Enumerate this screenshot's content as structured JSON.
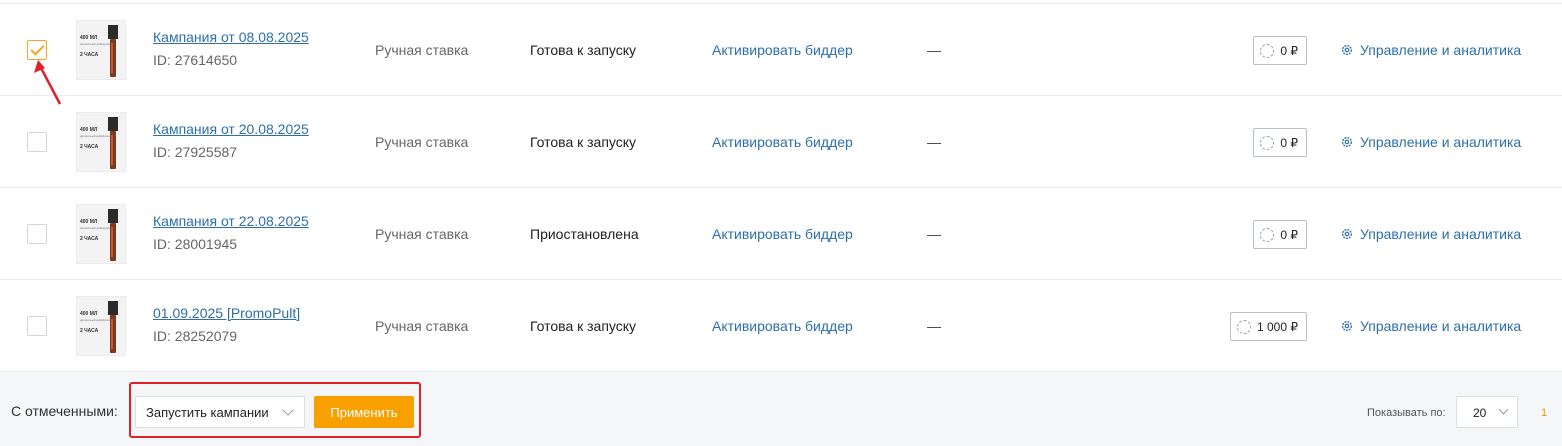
{
  "campaigns": [
    {
      "checked": true,
      "thumb": {
        "volume": "400 МЛ",
        "small": "ароматный диффузор",
        "duration": "2 ЧАСА"
      },
      "name": "Кампания от 08.08.2025",
      "id": "ID: 27614650",
      "bid_type": "Ручная ставка",
      "status": "Готова к запуску",
      "activate": "Активировать биддер",
      "dash": "—",
      "budget": "0 ₽",
      "manage": "Управление и аналитика"
    },
    {
      "checked": false,
      "thumb": {
        "volume": "400 МЛ",
        "small": "ароматный диффузор",
        "duration": "2 ЧАСА"
      },
      "name": "Кампания от 20.08.2025",
      "id": "ID: 27925587",
      "bid_type": "Ручная ставка",
      "status": "Готова к запуску",
      "activate": "Активировать биддер",
      "dash": "—",
      "budget": "0 ₽",
      "manage": "Управление и аналитика"
    },
    {
      "checked": false,
      "thumb": {
        "volume": "400 МЛ",
        "small": "ароматный диффузор",
        "duration": "2 ЧАСА"
      },
      "name": "Кампания от 22.08.2025",
      "id": "ID: 28001945",
      "bid_type": "Ручная ставка",
      "status": "Приостановлена",
      "activate": "Активировать биддер",
      "dash": "—",
      "budget": "0 ₽",
      "manage": "Управление и аналитика"
    },
    {
      "checked": false,
      "thumb": {
        "volume": "400 МЛ",
        "small": "ароматный диффузор",
        "duration": "2 ЧАСА"
      },
      "name": "01.09.2025 [PromoPult]",
      "id": "ID: 28252079",
      "bid_type": "Ручная ставка",
      "status": "Готова к запуску",
      "activate": "Активировать биддер",
      "dash": "—",
      "budget": "1 000 ₽",
      "manage": "Управление и аналитика"
    }
  ],
  "footer": {
    "with_selected_label": "С отмеченными:",
    "action_select_value": "Запустить кампании",
    "apply_label": "Применить",
    "show_label": "Показывать по:",
    "per_page_value": "20",
    "current_page": "1"
  },
  "colors": {
    "link": "#2d6fa8",
    "accent": "#f7a000",
    "highlight": "#e0202a"
  },
  "icons": [
    "checkmark-icon",
    "refresh-icon",
    "gear-icon",
    "chevron-down-icon",
    "red-arrow-annotation"
  ]
}
